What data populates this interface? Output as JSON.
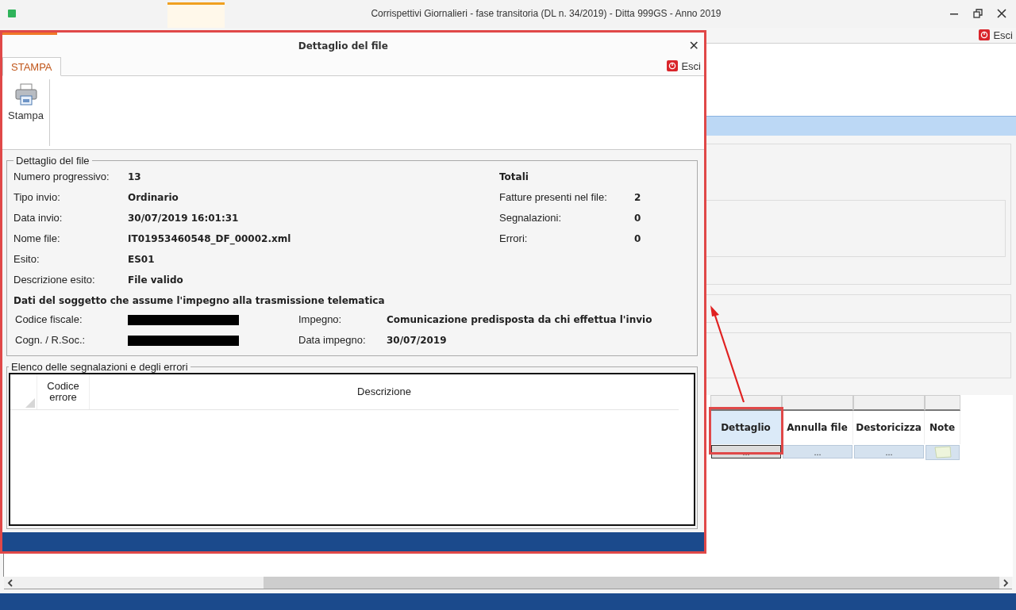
{
  "window": {
    "title": "Corrispettivi Giornalieri - fase transitoria (DL n. 34/2019) - Ditta 999GS - Anno 2019",
    "exit_label": "Esci"
  },
  "grid": {
    "columns": [
      {
        "label": "Dettaglio",
        "selected": true,
        "kind": "button",
        "cell": "..."
      },
      {
        "label": "Annulla file",
        "selected": false,
        "kind": "button",
        "cell": "..."
      },
      {
        "label": "Destoricizza",
        "selected": false,
        "kind": "button",
        "cell": "..."
      },
      {
        "label": "Note",
        "selected": false,
        "kind": "note"
      }
    ]
  },
  "dialog": {
    "title": "Dettaglio del file",
    "close": "✕",
    "tabs": [
      {
        "label": "STAMPA",
        "selected": true
      }
    ],
    "exit_label": "Esci",
    "print_button": "Stampa",
    "details": {
      "legend": "Dettaglio del file",
      "fields": [
        {
          "label": "Numero progressivo:",
          "value": "13"
        },
        {
          "label": "Tipo invio:",
          "value": "Ordinario"
        },
        {
          "label": "Data invio:",
          "value": "30/07/2019 16:01:31"
        },
        {
          "label": "Nome file:",
          "value": "IT01953460548_DF_00002.xml"
        },
        {
          "label": "Esito:",
          "value": "ES01"
        },
        {
          "label": "Descrizione esito:",
          "value": "File valido"
        }
      ],
      "totals": {
        "title": "Totali",
        "items": [
          {
            "label": "Fatture presenti nel file:",
            "value": "2"
          },
          {
            "label": "Segnalazioni:",
            "value": "0"
          },
          {
            "label": "Errori:",
            "value": "0"
          }
        ]
      },
      "subject_heading": "Dati del soggetto che assume l'impegno alla trasmissione telematica",
      "subject_fields": [
        {
          "label": "Codice fiscale:",
          "redacted": true
        },
        {
          "label": "Cogn. / R.Soc.:",
          "redacted": true
        }
      ],
      "commitment": [
        {
          "label": "Impegno:",
          "value": "Comunicazione predisposta da chi effettua l'invio"
        },
        {
          "label": "Data impegno:",
          "value": "30/07/2019"
        }
      ]
    },
    "errors": {
      "legend": "Elenco delle segnalazioni e degli errori",
      "columns": [
        "Codice errore",
        "Descrizione"
      ]
    }
  }
}
